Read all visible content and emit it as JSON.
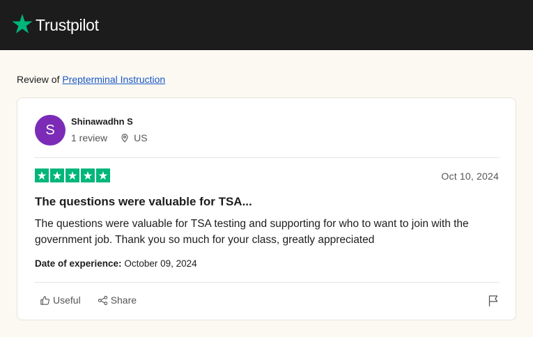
{
  "header": {
    "logo_text": "Trustpilot",
    "logo_icon": "star-icon",
    "logo_color": "#00b67a",
    "background": "#1c1c1c"
  },
  "review_of": {
    "prefix": "Review of",
    "company": "Prepterminal Instruction"
  },
  "review": {
    "avatar_initial": "S",
    "avatar_color": "#7b2bb6",
    "reviewer_name": "Shinawadhn S",
    "review_count": "1 review",
    "location": "US",
    "rating": 5,
    "star_color": "#00b67a",
    "date": "Oct 10, 2024",
    "title": "The questions were valuable for TSA...",
    "body": "The questions were valuable for TSA testing and supporting for who to want to join with the government job. Thank you so much for your class, greatly appreciated",
    "experience_label": "Date of experience:",
    "experience_date": "October 09, 2024"
  },
  "actions": {
    "useful_label": "Useful",
    "share_label": "Share",
    "useful_icon": "thumbs-up-icon",
    "share_icon": "share-icon",
    "report_icon": "flag-icon"
  }
}
